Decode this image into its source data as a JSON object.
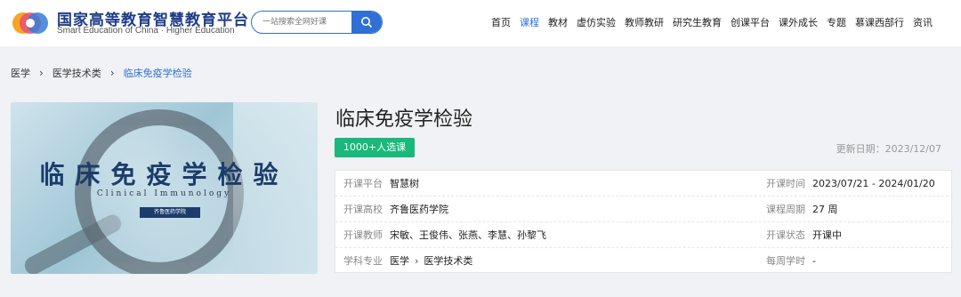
{
  "header": {
    "brand_cn": "国家高等教育智慧教育平台",
    "brand_en": "Smart Education of China · Higher Education",
    "search": {
      "placeholder": "一站搜索全网好课"
    },
    "nav": [
      {
        "label": "首页",
        "active": false
      },
      {
        "label": "课程",
        "active": true
      },
      {
        "label": "教材",
        "active": false
      },
      {
        "label": "虚仿实验",
        "active": false
      },
      {
        "label": "教师教研",
        "active": false
      },
      {
        "label": "研究生教育",
        "active": false
      },
      {
        "label": "创课平台",
        "active": false
      },
      {
        "label": "课外成长",
        "active": false
      },
      {
        "label": "专题",
        "active": false
      },
      {
        "label": "慕课西部行",
        "active": false
      },
      {
        "label": "资讯",
        "active": false
      }
    ]
  },
  "breadcrumb": {
    "items": [
      "医学",
      "医学技术类",
      "临床免疫学检验"
    ],
    "separator": "›"
  },
  "cover": {
    "title": "临床免疫学检验",
    "subtitle": "Clinical Immunology",
    "badge": "齐鲁医药学院"
  },
  "course": {
    "title": "临床免疫学检验",
    "enroll": "1000+人选课",
    "updated": "更新日期：2023/12/07",
    "info": {
      "platform_label": "开课平台",
      "platform": "智慧树",
      "time_label": "开课时间",
      "time": "2023/07/21 - 2024/01/20",
      "school_label": "开课高校",
      "school": "齐鲁医药学院",
      "period_label": "课程周期",
      "period": "27 周",
      "teacher_label": "开课教师",
      "teachers": "宋敏、王俊伟、张燕、李慧、孙黎飞",
      "status_label": "开课状态",
      "status": "开课中",
      "subject_label": "学科专业",
      "subject_1": "医学",
      "subject_sep": "›",
      "subject_2": "医学技术类",
      "hours_label": "每周学时",
      "hours": "-"
    }
  },
  "colors": {
    "accent": "#2f6fd6",
    "badge": "#1ab87a",
    "brand": "#1f3c88"
  }
}
